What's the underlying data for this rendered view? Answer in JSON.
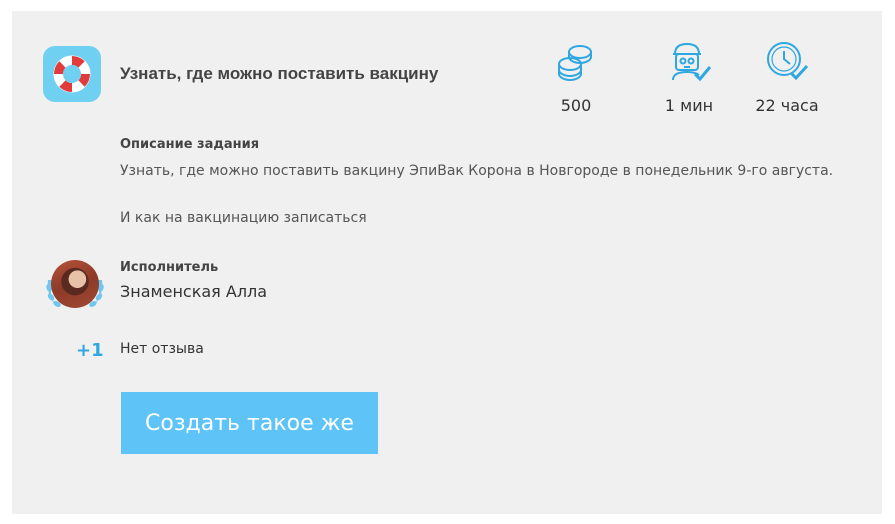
{
  "task": {
    "icon": "lifebuoy-icon",
    "title": "Узнать, где можно поставить вакцину"
  },
  "stats": {
    "reward": {
      "icon": "coins-icon",
      "value": "500"
    },
    "duration": {
      "icon": "worker-check-icon",
      "value": "1 мин"
    },
    "deadline": {
      "icon": "clock-check-icon",
      "value": "22 часа"
    }
  },
  "description": {
    "label": "Описание задания",
    "line1": "Узнать, где можно поставить вакцину ЭпиВак Корона в Новгороде в понедельник 9-го августа.",
    "line2": "И как на вакцинацию записаться"
  },
  "performer": {
    "label": "Исполнитель",
    "name": "Знаменская Алла"
  },
  "rating": {
    "points": "+1",
    "review": "Нет отзыва"
  },
  "actions": {
    "create_label": "Создать такое же"
  },
  "colors": {
    "accent": "#5ec4f8",
    "icon_stroke": "#2fa7e0",
    "card_bg": "#f0f0f0"
  }
}
